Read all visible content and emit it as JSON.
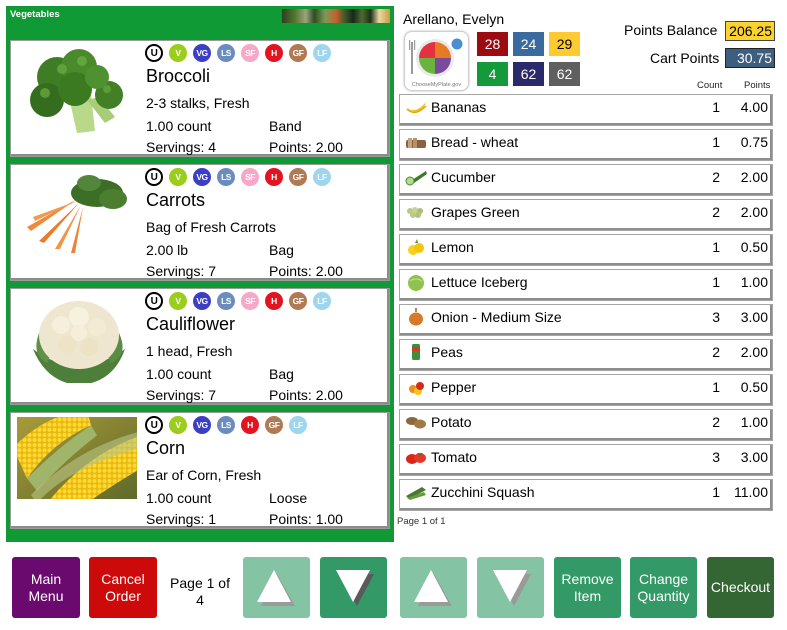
{
  "category": {
    "title": "Vegetables",
    "products": [
      {
        "name": "Broccoli",
        "image": "broccoli-image",
        "badges": [
          "U",
          "V",
          "VG",
          "LS",
          "SF",
          "H",
          "GF",
          "LF"
        ],
        "description": "2-3 stalks, Fresh",
        "quantity": "1.00 count",
        "package": "Band",
        "servings": "Servings: 4",
        "points": "Points: 2.00"
      },
      {
        "name": "Carrots",
        "image": "carrots-image",
        "badges": [
          "U",
          "V",
          "VG",
          "LS",
          "SF",
          "H",
          "GF",
          "LF"
        ],
        "description": "Bag of Fresh Carrots",
        "quantity": "2.00 lb",
        "package": "Bag",
        "servings": "Servings: 7",
        "points": "Points: 2.00"
      },
      {
        "name": "Cauliflower",
        "image": "cauliflower-image",
        "badges": [
          "U",
          "V",
          "VG",
          "LS",
          "SF",
          "H",
          "GF",
          "LF"
        ],
        "description": "1 head, Fresh",
        "quantity": "1.00 count",
        "package": "Bag",
        "servings": "Servings: 7",
        "points": "Points: 2.00"
      },
      {
        "name": "Corn",
        "image": "corn-image",
        "badges": [
          "U",
          "V",
          "VG",
          "LS",
          "H",
          "GF",
          "LF"
        ],
        "description": "Ear of Corn, Fresh",
        "quantity": "1.00 count",
        "package": "Loose",
        "servings": "Servings: 1",
        "points": "Points: 1.00"
      }
    ]
  },
  "badge_colors": {
    "U": "#ffffff",
    "V": "#9acd1c",
    "VG": "#3a3fc4",
    "LS": "#6b8cbf",
    "SF": "#f7a8c8",
    "H": "#e3141f",
    "GF": "#b07a55",
    "LF": "#9ed6ee"
  },
  "customer": {
    "name": "Arellano, Evelyn",
    "myplate_label": "ChooseMyPlate.gov",
    "stats": [
      {
        "value": "28",
        "color": "#9c0b10"
      },
      {
        "value": "24",
        "color": "#3a6b9e"
      },
      {
        "value": "29",
        "color": "#fdca2f",
        "text_color": "#000000"
      },
      {
        "value": "4",
        "color": "#16993a"
      },
      {
        "value": "62",
        "color": "#2a2a6a"
      },
      {
        "value": "62",
        "color": "#5f5f5f"
      }
    ]
  },
  "points": {
    "balance_label": "Points Balance",
    "balance_value": "206.25",
    "cart_label": "Cart Points",
    "cart_value": "30.75"
  },
  "cart": {
    "columns": {
      "count": "Count",
      "points": "Points"
    },
    "items": [
      {
        "name": "Bananas",
        "icon": "banana-icon",
        "count": "1",
        "points": "4.00"
      },
      {
        "name": "Bread - wheat",
        "icon": "bread-icon",
        "count": "1",
        "points": "0.75"
      },
      {
        "name": "Cucumber",
        "icon": "cucumber-icon",
        "count": "2",
        "points": "2.00"
      },
      {
        "name": "Grapes Green",
        "icon": "grapes-icon",
        "count": "2",
        "points": "2.00"
      },
      {
        "name": "Lemon",
        "icon": "lemon-icon",
        "count": "1",
        "points": "0.50"
      },
      {
        "name": "Lettuce Iceberg",
        "icon": "lettuce-icon",
        "count": "1",
        "points": "1.00"
      },
      {
        "name": "Onion - Medium Size",
        "icon": "onion-icon",
        "count": "3",
        "points": "3.00"
      },
      {
        "name": "Peas",
        "icon": "peas-can-icon",
        "count": "2",
        "points": "2.00"
      },
      {
        "name": "Pepper",
        "icon": "pepper-icon",
        "count": "1",
        "points": "0.50"
      },
      {
        "name": "Potato",
        "icon": "potato-icon",
        "count": "2",
        "points": "1.00"
      },
      {
        "name": "Tomato",
        "icon": "tomato-icon",
        "count": "3",
        "points": "3.00"
      },
      {
        "name": "Zucchini Squash",
        "icon": "zucchini-icon",
        "count": "1",
        "points": "11.00"
      }
    ],
    "page_label": "Page 1 of 1"
  },
  "footer": {
    "main_menu": "Main Menu",
    "cancel_order": "Cancel Order",
    "page_indicator": "Page 1 of 4",
    "remove_item": "Remove Item",
    "change_quantity": "Change Quantity",
    "checkout": "Checkout",
    "colors": {
      "main_menu": "#6b0a6e",
      "cancel_order": "#cc0a0a",
      "arrow_disabled": "#84c3a4",
      "arrow_enabled": "#339966",
      "action": "#339966",
      "checkout": "#336633"
    }
  }
}
